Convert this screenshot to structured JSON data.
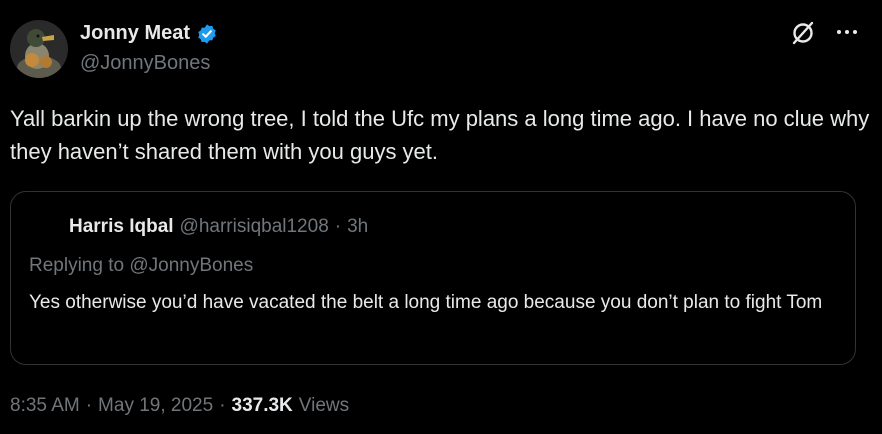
{
  "author": {
    "display_name": "Jonny Meat",
    "handle": "@JonnyBones",
    "verified": true,
    "avatar_icon": "duck-avatar",
    "verified_color": "#1d9bf0"
  },
  "icons": {
    "grok": "grok-icon",
    "more": "more-dots-icon"
  },
  "tweet": {
    "text": "Yall barkin up the wrong tree, I told the Ufc my plans a long time ago. I have no clue why they haven’t shared them with you guys yet."
  },
  "quoted_tweet": {
    "display_name": "Harris Iqbal",
    "handle": "@harrisiqbal1208",
    "separator": "·",
    "time": "3h",
    "replying_to": "Replying to @JonnyBones",
    "text": "Yes otherwise you’d have vacated the belt a long time ago because you don’t plan to fight Tom"
  },
  "footer": {
    "time": "8:35 AM",
    "sep1": "·",
    "date": "May 19, 2025",
    "sep2": "·",
    "views_count": "337.3K",
    "views_label": "Views"
  },
  "colors": {
    "background": "#000000",
    "text": "#e7e9ea",
    "secondary": "#71767b",
    "border": "#2f3336"
  }
}
